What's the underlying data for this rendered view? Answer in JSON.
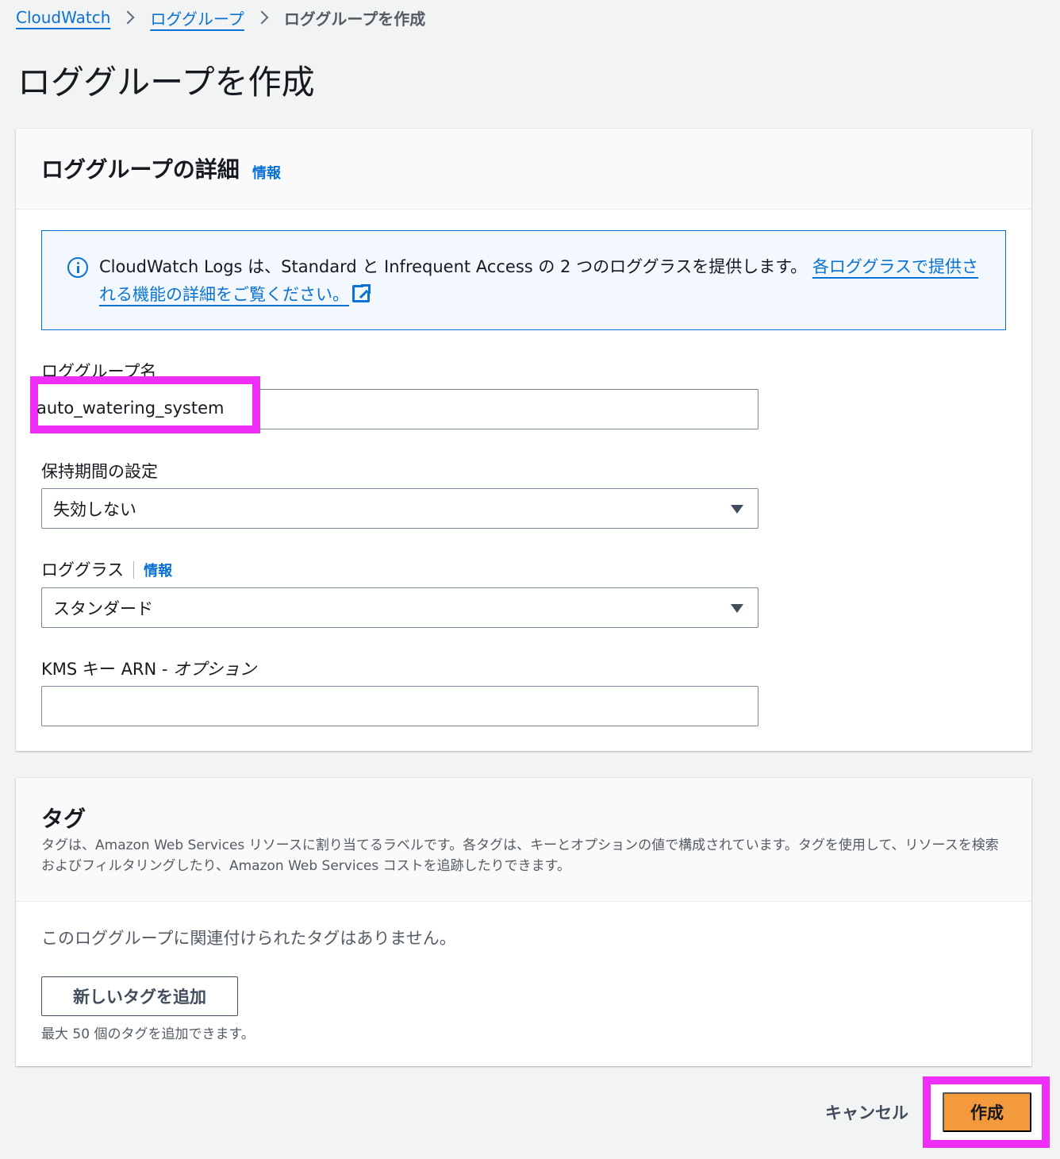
{
  "breadcrumb": {
    "items": [
      "CloudWatch",
      "ロググループ"
    ],
    "current": "ロググループを作成"
  },
  "page": {
    "title": "ロググループを作成"
  },
  "details": {
    "title": "ロググループの詳細",
    "info_link": "情報",
    "alert": {
      "text": "CloudWatch Logs は、Standard と Infrequent Access の 2 つのロググラスを提供します。",
      "link_text": "各ロググラスで提供される機能の詳細をご覧ください。"
    },
    "log_group_name": {
      "label": "ロググループ名",
      "value": "auto_watering_system"
    },
    "retention": {
      "label": "保持期間の設定",
      "selected": "失効しない"
    },
    "log_class": {
      "label": "ロググラス",
      "info_link": "情報",
      "selected": "スタンダード"
    },
    "kms": {
      "label": "KMS キー ARN - ",
      "label_optional": "オプション",
      "value": ""
    }
  },
  "tags": {
    "title": "タグ",
    "description": "タグは、Amazon Web Services リソースに割り当てるラベルです。各タグは、キーとオプションの値で構成されています。タグを使用して、リソースを検索およびフィルタリングしたり、Amazon Web Services コストを追跡したりできます。",
    "empty_text": "このロググループに関連付けられたタグはありません。",
    "add_button": "新しいタグを追加",
    "limit_hint": "最大 50 個のタグを追加できます。"
  },
  "actions": {
    "cancel": "キャンセル",
    "create": "作成"
  },
  "colors": {
    "link": "#0972d3",
    "primary_button": "#f39a3c",
    "highlight": "#ee2ef7"
  }
}
